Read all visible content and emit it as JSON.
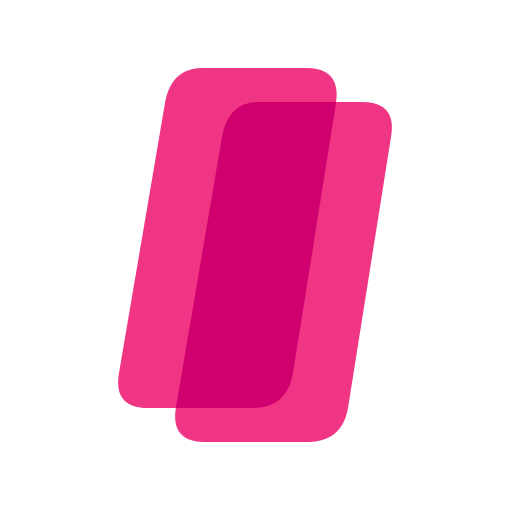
{
  "logo": {
    "icon_name": "two-overlapping-slanted-rounded-rectangles-logo",
    "colors": {
      "background": "#ffffff",
      "shape": "#ef3584",
      "overlap": "#d0006f"
    }
  }
}
